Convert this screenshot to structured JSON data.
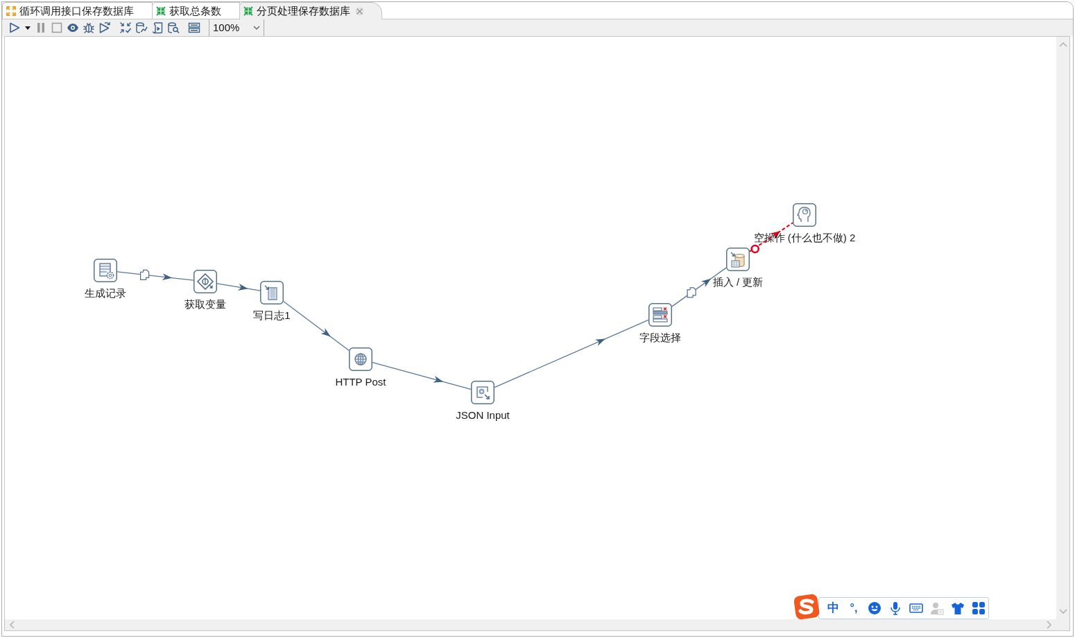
{
  "tabs": [
    {
      "label": "循环调用接口保存数据库",
      "kind": "job",
      "selected": false
    },
    {
      "label": "获取总条数",
      "kind": "transformation",
      "selected": false
    },
    {
      "label": "分页处理保存数据库",
      "kind": "transformation",
      "selected": true
    }
  ],
  "toolbar": {
    "groups": [
      [
        {
          "kind": "run",
          "disabled": false
        },
        {
          "kind": "run_menu",
          "disabled": false
        },
        {
          "kind": "pause",
          "disabled": true
        },
        {
          "kind": "stop",
          "disabled": true
        },
        {
          "kind": "preview",
          "disabled": false
        },
        {
          "kind": "debug",
          "disabled": false
        },
        {
          "kind": "replay",
          "disabled": false
        }
      ],
      [
        {
          "kind": "verify",
          "disabled": false
        },
        {
          "kind": "impact",
          "disabled": false
        },
        {
          "kind": "sql",
          "disabled": false
        },
        {
          "kind": "explore_db",
          "disabled": false
        }
      ],
      [
        {
          "kind": "show_results",
          "disabled": false
        }
      ]
    ],
    "zoom": "100%"
  },
  "canvas": {
    "steps": [
      {
        "label": "生成记录",
        "kind": "generate_rows"
      },
      {
        "label": "获取变量",
        "kind": "get_variables"
      },
      {
        "label": "写日志1",
        "kind": "write_log"
      },
      {
        "label": "HTTP Post",
        "kind": "http_post"
      },
      {
        "label": "JSON Input",
        "kind": "json_input"
      },
      {
        "label": "字段选择",
        "kind": "select_values"
      },
      {
        "label": "插入 / 更新",
        "kind": "insert_update"
      },
      {
        "label": "空操作 (什么也不做) 2",
        "kind": "dummy"
      }
    ],
    "hops": [
      {
        "kind": "normal",
        "copy_rows": true
      },
      {
        "kind": "normal",
        "copy_rows": false
      },
      {
        "kind": "normal",
        "copy_rows": false
      },
      {
        "kind": "normal",
        "copy_rows": false
      },
      {
        "kind": "normal",
        "copy_rows": false
      },
      {
        "kind": "normal",
        "copy_rows": true
      },
      {
        "kind": "error",
        "copy_rows": false
      }
    ]
  },
  "ime_toolbar": {
    "language_mode": "中",
    "punctuation_mode": "°,",
    "tools": [
      {
        "kind": "emoji",
        "disabled": false
      },
      {
        "kind": "voice",
        "disabled": false
      },
      {
        "kind": "keyboard",
        "disabled": false
      },
      {
        "kind": "account",
        "disabled": true
      },
      {
        "kind": "skin",
        "disabled": false
      },
      {
        "kind": "toolbox",
        "disabled": false
      }
    ]
  }
}
